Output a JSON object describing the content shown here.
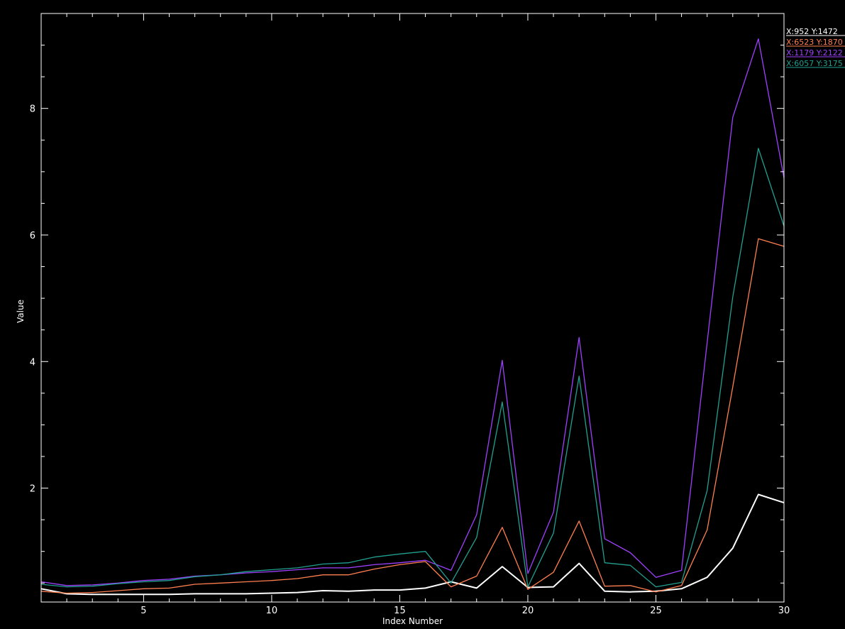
{
  "chart_data": {
    "type": "line",
    "title": "",
    "xlabel": "Index Number",
    "ylabel": "Value",
    "xlim": [
      1,
      30
    ],
    "ylim": [
      0.2,
      9.5
    ],
    "x_ticks": [
      5,
      10,
      15,
      20,
      25,
      30
    ],
    "y_ticks": [
      2,
      4,
      6,
      8
    ],
    "grid": false,
    "legend_position": "top-right, outside plot",
    "background": "#000000",
    "axis_color": "#ffffff",
    "x": [
      1,
      2,
      3,
      4,
      5,
      6,
      7,
      8,
      9,
      10,
      11,
      12,
      13,
      14,
      15,
      16,
      17,
      18,
      19,
      20,
      21,
      22,
      23,
      24,
      25,
      26,
      27,
      28,
      29,
      30
    ],
    "series": [
      {
        "name": "X:952 Y:1472",
        "color": "#ffffff",
        "values": [
          0.41,
          0.33,
          0.32,
          0.32,
          0.32,
          0.32,
          0.33,
          0.33,
          0.33,
          0.34,
          0.35,
          0.38,
          0.37,
          0.39,
          0.39,
          0.42,
          0.52,
          0.42,
          0.76,
          0.43,
          0.44,
          0.81,
          0.37,
          0.36,
          0.37,
          0.41,
          0.59,
          1.05,
          1.9,
          1.77
        ]
      },
      {
        "name": "X:6523 Y:1870",
        "color": "#ff7f50",
        "values": [
          0.37,
          0.34,
          0.35,
          0.38,
          0.41,
          0.42,
          0.48,
          0.5,
          0.52,
          0.54,
          0.57,
          0.63,
          0.63,
          0.72,
          0.79,
          0.84,
          0.44,
          0.61,
          1.38,
          0.4,
          0.67,
          1.48,
          0.45,
          0.46,
          0.36,
          0.46,
          1.34,
          3.6,
          5.94,
          5.82
        ]
      },
      {
        "name": "X:1179 Y:2122",
        "color": "#a040ff",
        "values": [
          0.52,
          0.46,
          0.47,
          0.5,
          0.54,
          0.56,
          0.61,
          0.63,
          0.66,
          0.68,
          0.71,
          0.74,
          0.74,
          0.79,
          0.82,
          0.86,
          0.7,
          1.58,
          4.02,
          0.65,
          1.62,
          4.38,
          1.2,
          0.98,
          0.59,
          0.7,
          4.3,
          7.86,
          9.1,
          6.9
        ]
      },
      {
        "name": "X:6057 Y:3175",
        "color": "#20a090",
        "values": [
          0.48,
          0.44,
          0.45,
          0.49,
          0.52,
          0.54,
          0.6,
          0.63,
          0.68,
          0.71,
          0.74,
          0.8,
          0.82,
          0.91,
          0.96,
          1.0,
          0.5,
          1.22,
          3.36,
          0.44,
          1.29,
          3.77,
          0.82,
          0.78,
          0.44,
          0.51,
          1.96,
          5.02,
          7.37,
          6.14
        ]
      }
    ]
  }
}
